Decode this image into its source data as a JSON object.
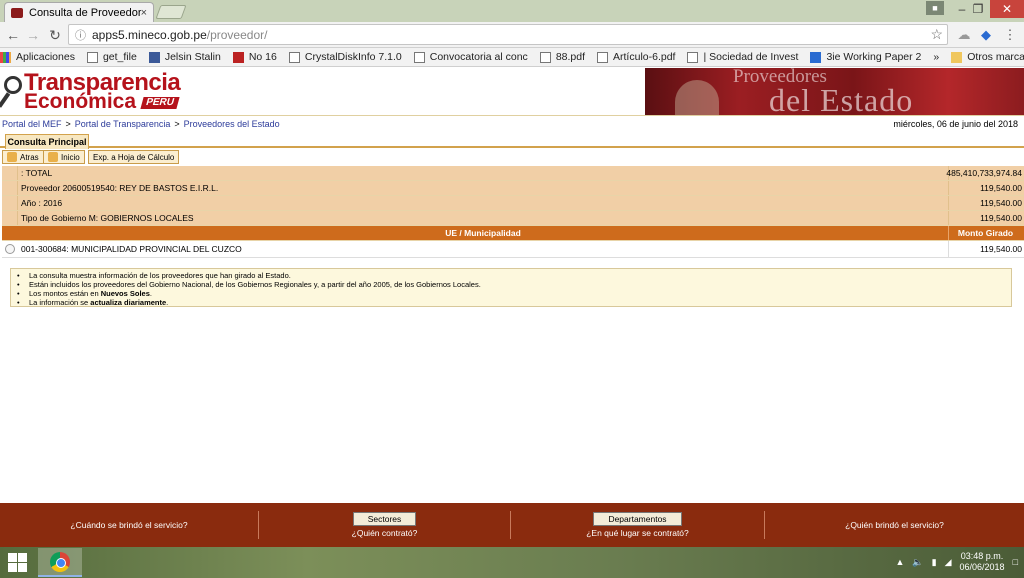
{
  "browser": {
    "tab_title": "Consulta de Proveedores",
    "tab_close": "×",
    "url_host": "apps5.mineco.gob.pe",
    "url_path": "/proveedor/",
    "bookmarks": [
      {
        "label": "Aplicaciones",
        "icon": "apps-grid-icon"
      },
      {
        "label": "get_file",
        "icon": "page-icon"
      },
      {
        "label": "Jelsin Stalin",
        "icon": "facebook-icon"
      },
      {
        "label": "No 16",
        "icon": "flag-icon"
      },
      {
        "label": "CrystalDiskInfo 7.1.0",
        "icon": "page-icon"
      },
      {
        "label": "Convocatoria al conc",
        "icon": "page-icon"
      },
      {
        "label": "88.pdf",
        "icon": "page-icon"
      },
      {
        "label": "Artículo-6.pdf",
        "icon": "page-icon"
      },
      {
        "label": "| Sociedad de Invest",
        "icon": "page-icon"
      },
      {
        "label": "3ie Working Paper 2",
        "icon": "doc-icon"
      }
    ],
    "bookmarks_more": "»",
    "other_bookmarks": "Otros marcadores"
  },
  "site": {
    "logo_line1": "Transparencia",
    "logo_line2": "Económica",
    "logo_peru": "PERU",
    "banner_line1": "Proveedores",
    "banner_line2": "del Estado",
    "breadcrumb": [
      "Portal del MEF",
      "Portal de Transparencia",
      "Proveedores del Estado"
    ],
    "breadcrumb_sep": ">",
    "date": "miércoles, 06 de junio del 2018",
    "main_tab": "Consulta Principal",
    "actions": {
      "back": "Atras",
      "home": "Inicio",
      "export": "Exp. a Hoja de Cálculo"
    }
  },
  "table": {
    "summary_rows": [
      {
        "label": ": TOTAL",
        "value": "485,410,733,974.84"
      },
      {
        "label": "Proveedor 20600519540: REY DE BASTOS E.I.R.L.",
        "value": "119,540.00"
      },
      {
        "label": "Año : 2016",
        "value": "119,540.00"
      },
      {
        "label": "Tipo de Gobierno M: GOBIERNOS LOCALES",
        "value": "119,540.00"
      }
    ],
    "header": {
      "label": "UE / Municipalidad",
      "value": "Monto Girado"
    },
    "rows": [
      {
        "label": "001-300684: MUNICIPALIDAD PROVINCIAL DEL CUZCO",
        "value": "119,540.00"
      }
    ]
  },
  "info": {
    "line1": "La consulta muestra información de los proveedores que han girado al Estado.",
    "line2": "Están incluidos los proveedores del Gobierno Nacional, de los Gobiernos Regionales y, a partir del año 2005, de los Gobiernos Locales.",
    "line3_prefix": "Los montos están en ",
    "line3_bold": "Nuevos Soles",
    "line3_suffix": ".",
    "line4_prefix": "La información se ",
    "line4_bold": "actualiza diariamente",
    "line4_suffix": "."
  },
  "footer": {
    "q_when": "¿Cuándo se brindó el servicio?",
    "btn_sectores": "Sectores",
    "q_who_hired": "¿Quién contrató?",
    "btn_departamentos": "Departamentos",
    "q_where": "¿En qué lugar se contrató?",
    "q_who_served": "¿Quién brindó el servicio?"
  },
  "taskbar": {
    "time": "03:48 p.m.",
    "date": "06/06/2018"
  }
}
